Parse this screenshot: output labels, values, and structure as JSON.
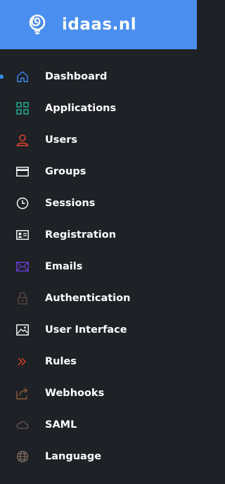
{
  "header": {
    "brand": "idaas.nl",
    "bg": "#4a8ff0",
    "logo_icon": "lightbulb-icon"
  },
  "sidebar": {
    "active_index": 0,
    "items": [
      {
        "label": "Dashboard",
        "icon": "home-icon",
        "color": "#3a8df5"
      },
      {
        "label": "Applications",
        "icon": "apps-grid-icon",
        "color": "#1fb89a"
      },
      {
        "label": "Users",
        "icon": "user-icon",
        "color": "#e8452e"
      },
      {
        "label": "Groups",
        "icon": "card-icon",
        "color": "#ffffff"
      },
      {
        "label": "Sessions",
        "icon": "clock-icon",
        "color": "#ffffff"
      },
      {
        "label": "Registration",
        "icon": "id-card-icon",
        "color": "#ffffff"
      },
      {
        "label": "Emails",
        "icon": "envelope-icon",
        "color": "#6a3fd4"
      },
      {
        "label": "Authentication",
        "icon": "lock-icon",
        "color": "#5a4540"
      },
      {
        "label": "User Interface",
        "icon": "picture-icon",
        "color": "#ffffff"
      },
      {
        "label": "Rules",
        "icon": "fast-forward-icon",
        "color": "#d33a2a"
      },
      {
        "label": "Webhooks",
        "icon": "share-icon",
        "color": "#8a5a3a"
      },
      {
        "label": "SAML",
        "icon": "cloud-icon",
        "color": "#6a5a55"
      },
      {
        "label": "Language",
        "icon": "globe-icon",
        "color": "#7a6a60"
      }
    ]
  }
}
